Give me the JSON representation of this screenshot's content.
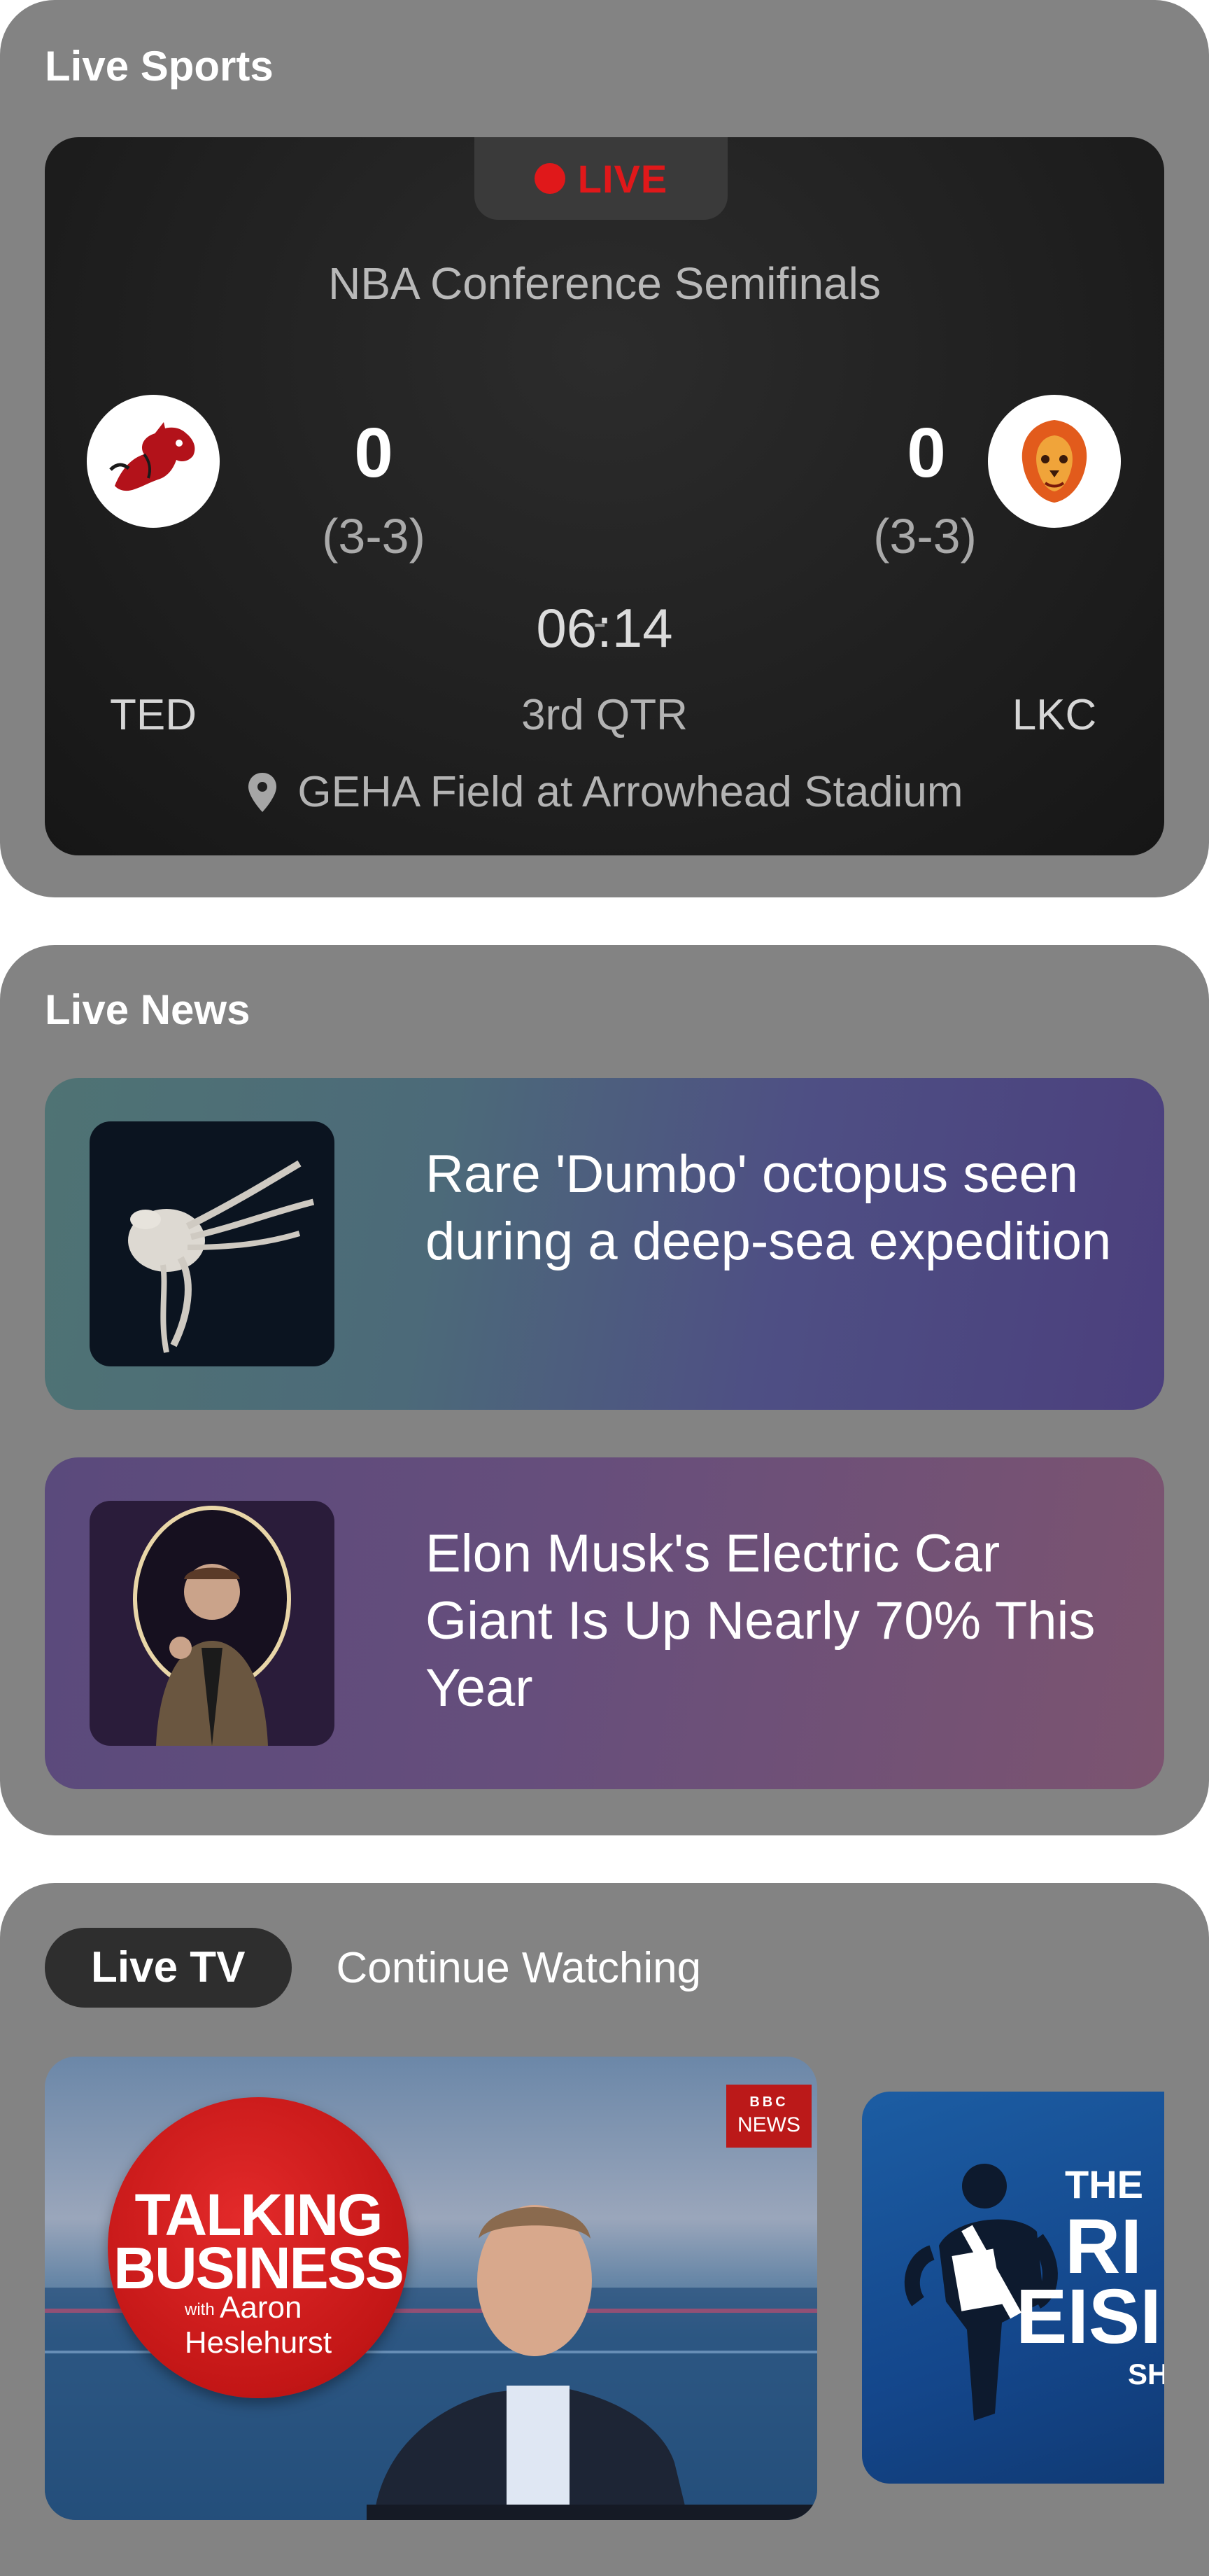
{
  "live_sports": {
    "section_title": "Live Sports",
    "live_label": "LIVE",
    "league": "NBA Conference Semifinals",
    "home": {
      "abbr": "TED",
      "score": "0",
      "record": "(3-3)"
    },
    "away": {
      "abbr": "LKC",
      "score": "0",
      "record": "(3-3)"
    },
    "separator": "-",
    "clock": "06:14",
    "period": "3rd QTR",
    "venue": "GEHA Field at Arrowhead Stadium"
  },
  "live_news": {
    "section_title": "Live News",
    "items": [
      {
        "headline": "Rare 'Dumbo' octopus seen during a deep-sea expedition"
      },
      {
        "headline": "Elon Musk's Electric Car Giant Is Up Nearly 70% This Year"
      }
    ]
  },
  "live_tv": {
    "tabs": [
      {
        "label": "Live TV"
      },
      {
        "label": "Continue Watching"
      }
    ],
    "main_card": {
      "show_line1": "TALKING",
      "show_line2": "BUSINESS",
      "with": "with",
      "host_first": "Aaron",
      "host_last": "Heslehurst",
      "network_top": "BBC",
      "network_bottom": "NEWS"
    },
    "side_card": {
      "line1": "THE",
      "line2": "RI",
      "line3": "EISI",
      "line4": "SH"
    }
  },
  "colors": {
    "panel_bg": "#838383",
    "live_red": "#e0181a",
    "card_dark": "#202020"
  }
}
